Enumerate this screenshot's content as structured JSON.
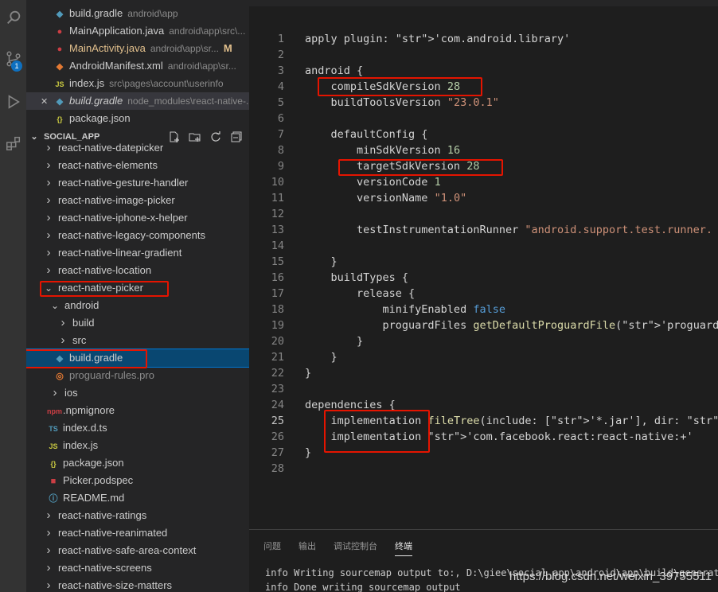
{
  "activity_bar": {
    "icons": [
      "search-icon",
      "source-control-icon",
      "run-debug-icon",
      "extensions-icon"
    ],
    "scm_badge": "1"
  },
  "open_editors": [
    {
      "icon": "gradle-icon",
      "name": "build.gradle",
      "path": "android\\app"
    },
    {
      "icon": "java-icon",
      "name": "MainApplication.java",
      "path": "android\\app\\src\\..."
    },
    {
      "icon": "java-icon",
      "name": "MainActivity.java",
      "path": "android\\app\\sr...",
      "status": "M"
    },
    {
      "icon": "xml-icon",
      "name": "AndroidManifest.xml",
      "path": "android\\app\\sr..."
    },
    {
      "icon": "js-icon",
      "name": "index.js",
      "path": "src\\pages\\account\\userinfo"
    },
    {
      "icon": "gradle-icon",
      "name": "build.gradle",
      "path": "node_modules\\react-native-..."
    },
    {
      "icon": "json-icon",
      "name": "package.json",
      "path": ""
    }
  ],
  "explorer": {
    "section_title": "SOCIAL_APP",
    "items": [
      {
        "label": "react-native-datepicker",
        "type": "folder"
      },
      {
        "label": "react-native-elements",
        "type": "folder"
      },
      {
        "label": "react-native-gesture-handler",
        "type": "folder"
      },
      {
        "label": "react-native-image-picker",
        "type": "folder"
      },
      {
        "label": "react-native-iphone-x-helper",
        "type": "folder"
      },
      {
        "label": "react-native-legacy-components",
        "type": "folder"
      },
      {
        "label": "react-native-linear-gradient",
        "type": "folder"
      },
      {
        "label": "react-native-location",
        "type": "folder"
      },
      {
        "label": "react-native-picker",
        "type": "folder-open"
      },
      {
        "label": "android",
        "type": "folder-open"
      },
      {
        "label": "build",
        "type": "folder"
      },
      {
        "label": "src",
        "type": "folder"
      },
      {
        "label": "build.gradle",
        "type": "gradle"
      },
      {
        "label": "proguard-rules.pro",
        "type": "pro"
      },
      {
        "label": "ios",
        "type": "folder"
      },
      {
        "label": ".npmignore",
        "type": "npm"
      },
      {
        "label": "index.d.ts",
        "type": "ts"
      },
      {
        "label": "index.js",
        "type": "js"
      },
      {
        "label": "package.json",
        "type": "json"
      },
      {
        "label": "Picker.podspec",
        "type": "podspec"
      },
      {
        "label": "README.md",
        "type": "md"
      },
      {
        "label": "react-native-ratings",
        "type": "folder"
      },
      {
        "label": "react-native-reanimated",
        "type": "folder"
      },
      {
        "label": "react-native-safe-area-context",
        "type": "folder"
      },
      {
        "label": "react-native-screens",
        "type": "folder"
      },
      {
        "label": "react-native-size-matters",
        "type": "folder"
      }
    ]
  },
  "editor": {
    "current_line": "25",
    "lines": [
      {
        "n": "1",
        "text": "apply plugin: 'com.android.library'"
      },
      {
        "n": "2",
        "text": ""
      },
      {
        "n": "3",
        "text": "android {"
      },
      {
        "n": "4",
        "text": "    compileSdkVersion 28"
      },
      {
        "n": "5",
        "text": "    buildToolsVersion \"23.0.1\""
      },
      {
        "n": "6",
        "text": ""
      },
      {
        "n": "7",
        "text": "    defaultConfig {"
      },
      {
        "n": "8",
        "text": "        minSdkVersion 16"
      },
      {
        "n": "9",
        "text": "        targetSdkVersion 28"
      },
      {
        "n": "10",
        "text": "        versionCode 1"
      },
      {
        "n": "11",
        "text": "        versionName \"1.0\""
      },
      {
        "n": "12",
        "text": ""
      },
      {
        "n": "13",
        "text": "        testInstrumentationRunner \"android.support.test.runner."
      },
      {
        "n": "14",
        "text": ""
      },
      {
        "n": "15",
        "text": "    }"
      },
      {
        "n": "16",
        "text": "    buildTypes {"
      },
      {
        "n": "17",
        "text": "        release {"
      },
      {
        "n": "18",
        "text": "            minifyEnabled false"
      },
      {
        "n": "19",
        "text": "            proguardFiles getDefaultProguardFile('proguard-andr"
      },
      {
        "n": "20",
        "text": "        }"
      },
      {
        "n": "21",
        "text": "    }"
      },
      {
        "n": "22",
        "text": "}"
      },
      {
        "n": "23",
        "text": ""
      },
      {
        "n": "24",
        "text": "dependencies {"
      },
      {
        "n": "25",
        "text": "    implementation fileTree(include: ['*.jar'], dir: 'libs')"
      },
      {
        "n": "26",
        "text": "    implementation 'com.facebook.react:react-native:+'"
      },
      {
        "n": "27",
        "text": "}"
      },
      {
        "n": "28",
        "text": ""
      }
    ]
  },
  "panel": {
    "tabs": [
      "问题",
      "输出",
      "调试控制台",
      "终端"
    ],
    "active_tab": "终端",
    "terminal_lines": [
      "info Writing sourcemap output to:, D:\\giee\\social_app\\android\\app\\build\\generated\\",
      "info Done writing sourcemap output"
    ],
    "watermark": "https://blog.csdn.net/weixin_39755511"
  },
  "colors": {
    "highlight_box": "#e51400",
    "selection": "#094771",
    "string": "#ce9178",
    "keyword_blue": "#569cd6",
    "number": "#b5cea8"
  }
}
